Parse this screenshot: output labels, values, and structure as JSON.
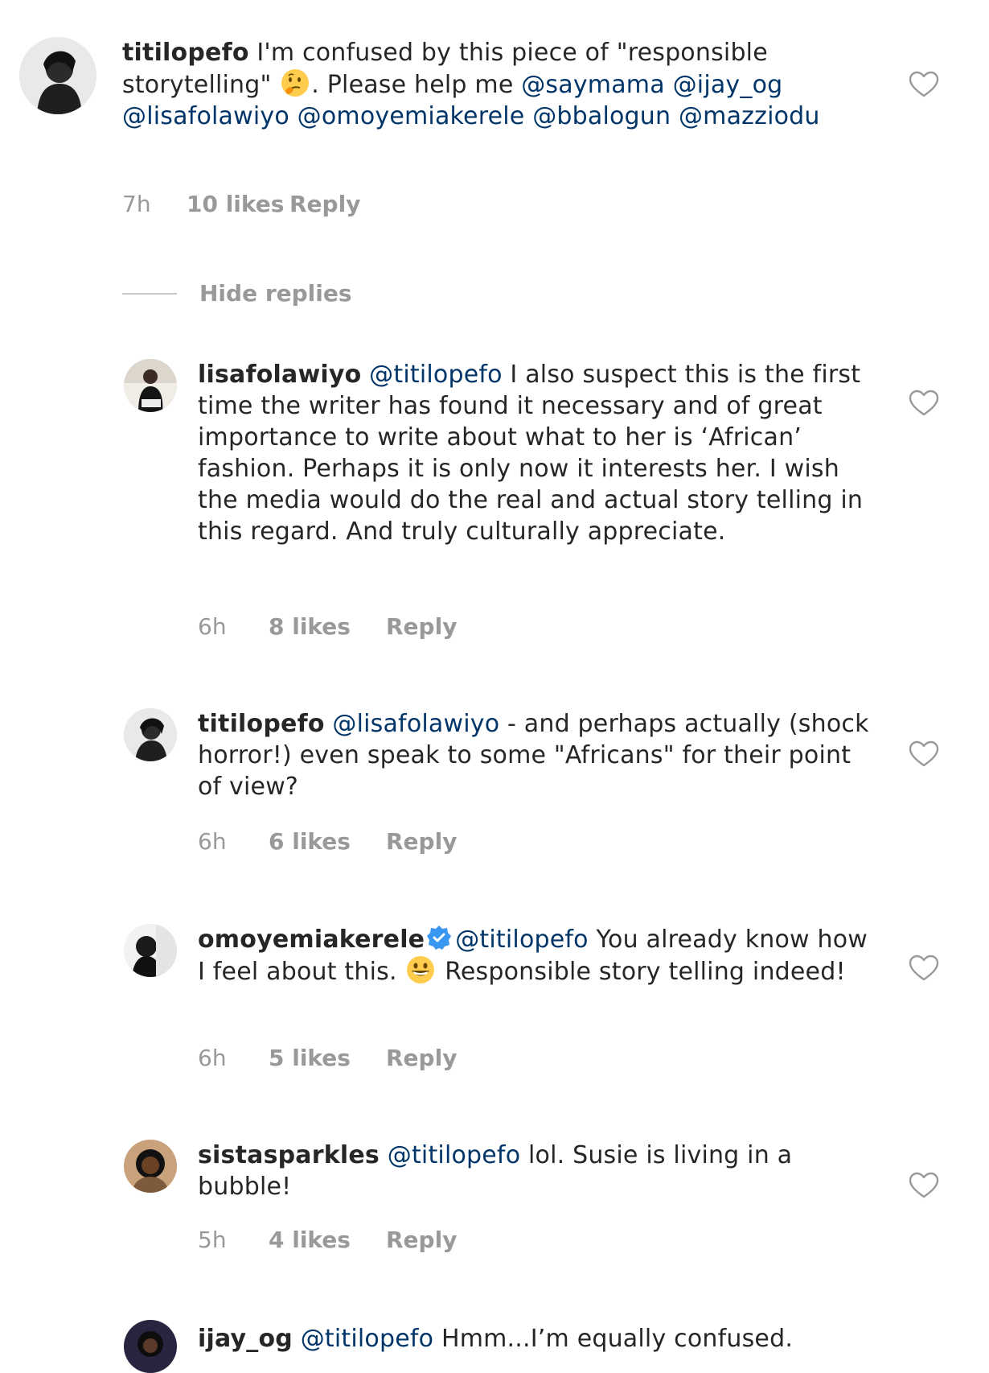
{
  "heart_icon": "heart-outline-icon",
  "colors": {
    "username": "#262626",
    "mention": "#003569",
    "meta": "#999999",
    "verified": "#3897f0"
  },
  "hide_replies_label": "Hide replies",
  "comments": [
    {
      "username": "titilopefo",
      "segments": [
        {
          "t": "text",
          "v": " I'm confused by this piece of \"responsible storytelling\" "
        },
        {
          "t": "emoji",
          "v": "thinking-face-emoji"
        },
        {
          "t": "text",
          "v": ". Please help me "
        },
        {
          "t": "mention",
          "v": "@saymama"
        },
        {
          "t": "text",
          "v": " "
        },
        {
          "t": "mention",
          "v": "@ijay_og"
        },
        {
          "t": "text",
          "v": " "
        },
        {
          "t": "mention",
          "v": "@lisafolawiyo"
        },
        {
          "t": "text",
          "v": " "
        },
        {
          "t": "mention",
          "v": "@omoyemiakerele"
        },
        {
          "t": "text",
          "v": " "
        },
        {
          "t": "mention",
          "v": "@bbalogun"
        },
        {
          "t": "text",
          "v": " "
        },
        {
          "t": "mention",
          "v": "@mazziodu"
        }
      ],
      "time": "7h",
      "likes": "10 likes",
      "reply": "Reply",
      "avatar": "avatar-titilopefo"
    },
    {
      "username": "lisafolawiyo",
      "segments": [
        {
          "t": "text",
          "v": " "
        },
        {
          "t": "mention",
          "v": "@titilopefo"
        },
        {
          "t": "text",
          "v": " I also suspect this is the first time the writer has found it necessary and of great importance to write about what to her is ‘African’ fashion. Perhaps it is only now it interests her. I wish the media would do the real and actual story telling in this regard. And truly culturally appreciate."
        }
      ],
      "time": "6h",
      "likes": "8 likes",
      "reply": "Reply",
      "avatar": "avatar-lisafolawiyo"
    },
    {
      "username": "titilopefo",
      "segments": [
        {
          "t": "text",
          "v": " "
        },
        {
          "t": "mention",
          "v": "@lisafolawiyo"
        },
        {
          "t": "text",
          "v": " - and perhaps actually (shock horror!) even speak to some \"Africans\" for their point of view?"
        }
      ],
      "time": "6h",
      "likes": "6 likes",
      "reply": "Reply",
      "avatar": "avatar-titilopefo"
    },
    {
      "username": "omoyemiakerele",
      "verified": true,
      "segments": [
        {
          "t": "mention",
          "v": "@titilopefo"
        },
        {
          "t": "text",
          "v": " You already know how I feel about this. "
        },
        {
          "t": "emoji",
          "v": "grinning-face-emoji"
        },
        {
          "t": "text",
          "v": " Responsible story telling indeed!"
        }
      ],
      "time": "6h",
      "likes": "5 likes",
      "reply": "Reply",
      "avatar": "avatar-omoyemiakerele"
    },
    {
      "username": "sistasparkles",
      "segments": [
        {
          "t": "text",
          "v": " "
        },
        {
          "t": "mention",
          "v": "@titilopefo"
        },
        {
          "t": "text",
          "v": " lol. Susie is living in a bubble!"
        }
      ],
      "time": "5h",
      "likes": "4 likes",
      "reply": "Reply",
      "avatar": "avatar-sistasparkles"
    },
    {
      "username": "ijay_og",
      "segments": [
        {
          "t": "text",
          "v": " "
        },
        {
          "t": "mention",
          "v": "@titilopefo"
        },
        {
          "t": "text",
          "v": " Hmm...I’m equally confused."
        }
      ],
      "avatar": "avatar-ijay_og"
    }
  ]
}
